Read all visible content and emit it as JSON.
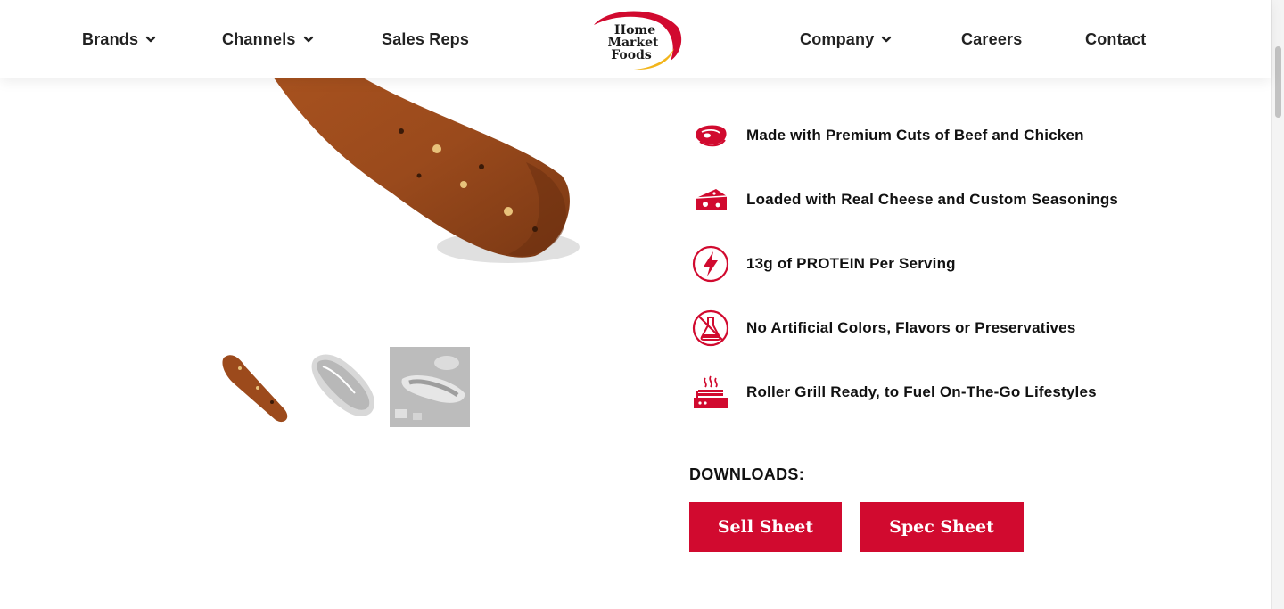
{
  "nav": {
    "left": [
      {
        "label": "Brands",
        "dropdown": true
      },
      {
        "label": "Channels",
        "dropdown": true
      },
      {
        "label": "Sales Reps",
        "dropdown": false
      }
    ],
    "right": [
      {
        "label": "Company",
        "dropdown": true
      },
      {
        "label": "Careers",
        "dropdown": false
      },
      {
        "label": "Contact",
        "dropdown": false
      }
    ],
    "logo": {
      "line1": "Home",
      "line2": "Market",
      "line3": "Foods"
    }
  },
  "features": [
    {
      "icon": "steak-icon",
      "text": "Made with Premium Cuts of Beef and Chicken"
    },
    {
      "icon": "cheese-icon",
      "text": "Loaded with Real Cheese and Custom Seasonings"
    },
    {
      "icon": "lightning-bolt-icon",
      "text": "13g of PROTEIN Per Serving"
    },
    {
      "icon": "no-flask-icon",
      "text": "No Artificial Colors, Flavors or Preservatives"
    },
    {
      "icon": "roller-grill-icon",
      "text": "Roller Grill Ready, to Fuel On-The-Go Lifestyles"
    }
  ],
  "downloads": {
    "title": "DOWNLOADS:",
    "sell_sheet": "Sell Sheet",
    "spec_sheet": "Spec Sheet"
  },
  "colors": {
    "accent": "#d10a2f",
    "logo_yellow": "#f2b51b",
    "text": "#111111"
  }
}
